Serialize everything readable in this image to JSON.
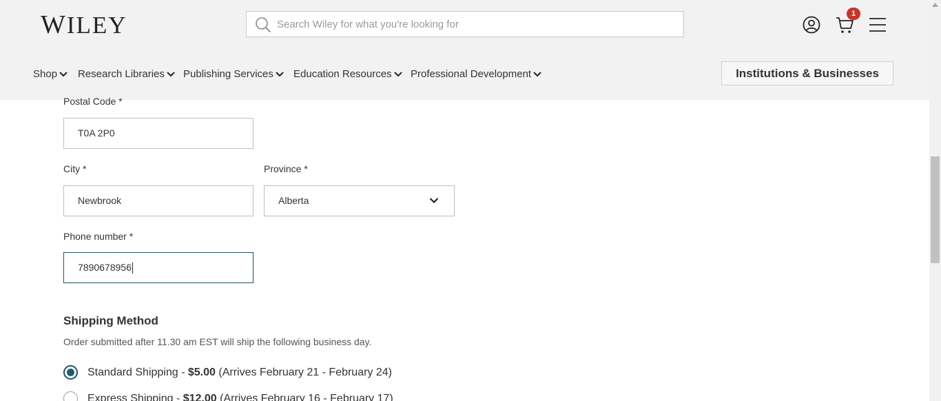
{
  "header": {
    "logo_first": "W",
    "logo_rest": "ILEY",
    "search_placeholder": "Search Wiley for what you're looking for",
    "cart_count": "1"
  },
  "nav": {
    "items": [
      {
        "label": "Shop"
      },
      {
        "label": "Research Libraries"
      },
      {
        "label": "Publishing Services"
      },
      {
        "label": "Education Resources"
      },
      {
        "label": "Professional Development"
      }
    ],
    "institutions_label": "Institutions & Businesses"
  },
  "form": {
    "postal_label": "Postal Code *",
    "postal_value": "T0A 2P0",
    "city_label": "City *",
    "city_value": "Newbrook",
    "province_label": "Province *",
    "province_value": "Alberta",
    "phone_label": "Phone number *",
    "phone_value": "7890678956"
  },
  "shipping": {
    "title": "Shipping Method",
    "note": "Order submitted after 11.30 am EST will ship the following business day.",
    "options": [
      {
        "name": "Standard Shipping - ",
        "price": "$5.00",
        "arrival": " (Arrives February 21 - February 24)",
        "selected": true
      },
      {
        "name": "Express Shipping - ",
        "price": "$12.00",
        "arrival": " (Arrives February 16 - February 17)",
        "selected": false
      }
    ]
  }
}
